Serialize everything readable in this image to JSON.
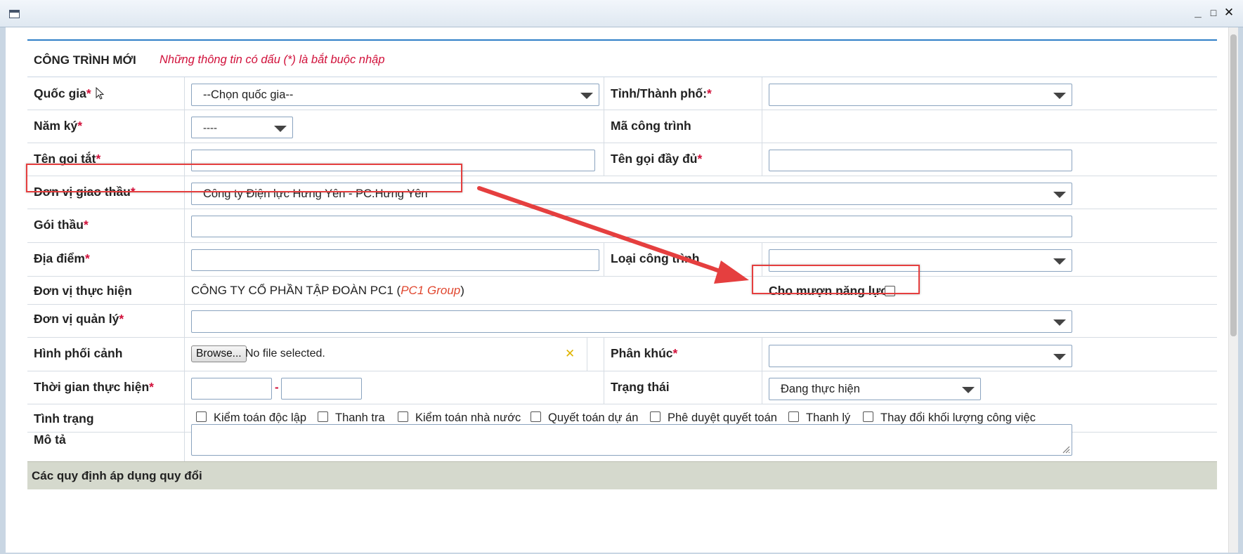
{
  "window": {
    "controls": [
      "_",
      "□",
      "✕"
    ]
  },
  "form": {
    "title": "CÔNG TRÌNH MỚI",
    "note": "Những thông tin có dấu (*) là bắt buộc nhập",
    "required_mark": "*",
    "quoc_gia": {
      "label": "Quốc gia",
      "value": "--Chọn quốc gia--"
    },
    "tinh_thanh": {
      "label": "Tỉnh/Thành phố:",
      "value": ""
    },
    "nam_ky": {
      "label": "Năm ký",
      "value": "----"
    },
    "ma_cong_trinh": {
      "label": "Mã công trình",
      "value": ""
    },
    "ten_goi_tat": {
      "label": "Tên gọi tắt",
      "value": ""
    },
    "ten_goi_day_du": {
      "label": "Tên gọi đầy đủ",
      "value": ""
    },
    "don_vi_giao_thau": {
      "label": "Đơn vị giao thầu",
      "value": "Công ty Điện lực Hưng Yên - PC.Hưng Yên"
    },
    "goi_thau": {
      "label": "Gói thầu",
      "value": ""
    },
    "dia_diem": {
      "label": "Địa điểm",
      "value": ""
    },
    "loai_cong_trinh": {
      "label": "Loại công trình",
      "value": ""
    },
    "don_vi_thuc_hien": {
      "label": "Đơn vị thực hiện",
      "company": "CÔNG TY CỔ PHẦN TẬP ĐOÀN PC1 (",
      "company_short": "PC1 Group",
      "company_close": ")"
    },
    "cho_muon_nang_luc": {
      "label": "Cho mượn năng lực?",
      "checked": false
    },
    "don_vi_quan_ly": {
      "label": "Đơn vị quản lý",
      "value": ""
    },
    "hinh_phoi_canh": {
      "label": "Hình phối cảnh",
      "browse": "Browse...",
      "status": "No file selected.",
      "clear_icon": "✕"
    },
    "phan_khuc": {
      "label": "Phân khúc",
      "value": ""
    },
    "thoi_gian": {
      "label": "Thời gian thực hiện",
      "separator": "-",
      "from": "",
      "to": ""
    },
    "trang_thai": {
      "label": "Trạng thái",
      "value": "Đang thực hiện"
    },
    "tinh_trang": {
      "label": "Tình trạng",
      "options": [
        "Kiểm toán độc lập",
        "Thanh tra",
        "Kiểm toán nhà nước",
        "Quyết toán dự án",
        "Phê duyệt quyết toán",
        "Thanh lý",
        "Thay đổi khối lượng công việc"
      ]
    },
    "mo_ta": {
      "label": "Mô tả",
      "value": ""
    },
    "section_quy_dinh": "Các quy định áp dụng quy đổi"
  },
  "colors": {
    "required": "#d1103a",
    "annotation": "#e53f3f",
    "accent": "#2f7fc7"
  }
}
